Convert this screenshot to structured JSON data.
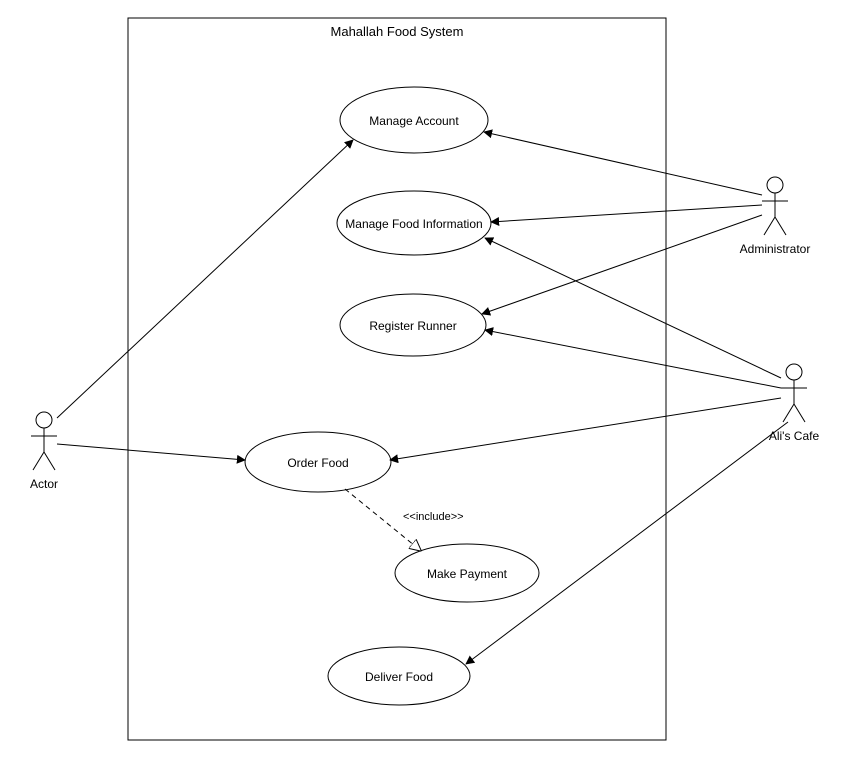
{
  "system": {
    "title": "Mahallah Food System"
  },
  "actors": {
    "left": {
      "label": "Actor"
    },
    "topRight": {
      "label": "Administrator"
    },
    "midRight": {
      "label": "Ali's Cafe"
    }
  },
  "usecases": {
    "manageAccount": {
      "label": "Manage Account"
    },
    "manageFoodInfo": {
      "label": "Manage Food Information"
    },
    "registerRunner": {
      "label": "Register Runner"
    },
    "orderFood": {
      "label": "Order Food"
    },
    "makePayment": {
      "label": "Make Payment"
    },
    "deliverFood": {
      "label": "Deliver  Food"
    }
  },
  "relations": {
    "includeStereotype": "<<include>>"
  },
  "chart_data": {
    "type": "table",
    "title": "Use Case Diagram — Mahallah Food System",
    "actors": [
      "Actor",
      "Administrator",
      "Ali's Cafe"
    ],
    "usecases": [
      "Manage Account",
      "Manage Food Information",
      "Register Runner",
      "Order Food",
      "Make Payment",
      "Deliver Food"
    ],
    "associations": [
      {
        "actor": "Actor",
        "usecase": "Manage Account"
      },
      {
        "actor": "Actor",
        "usecase": "Order Food"
      },
      {
        "actor": "Administrator",
        "usecase": "Manage Account"
      },
      {
        "actor": "Administrator",
        "usecase": "Manage Food Information"
      },
      {
        "actor": "Administrator",
        "usecase": "Register Runner"
      },
      {
        "actor": "Ali's Cafe",
        "usecase": "Manage Food Information"
      },
      {
        "actor": "Ali's Cafe",
        "usecase": "Register Runner"
      },
      {
        "actor": "Ali's Cafe",
        "usecase": "Order Food"
      },
      {
        "actor": "Ali's Cafe",
        "usecase": "Deliver Food"
      }
    ],
    "includes": [
      {
        "from": "Order Food",
        "to": "Make Payment"
      }
    ]
  }
}
